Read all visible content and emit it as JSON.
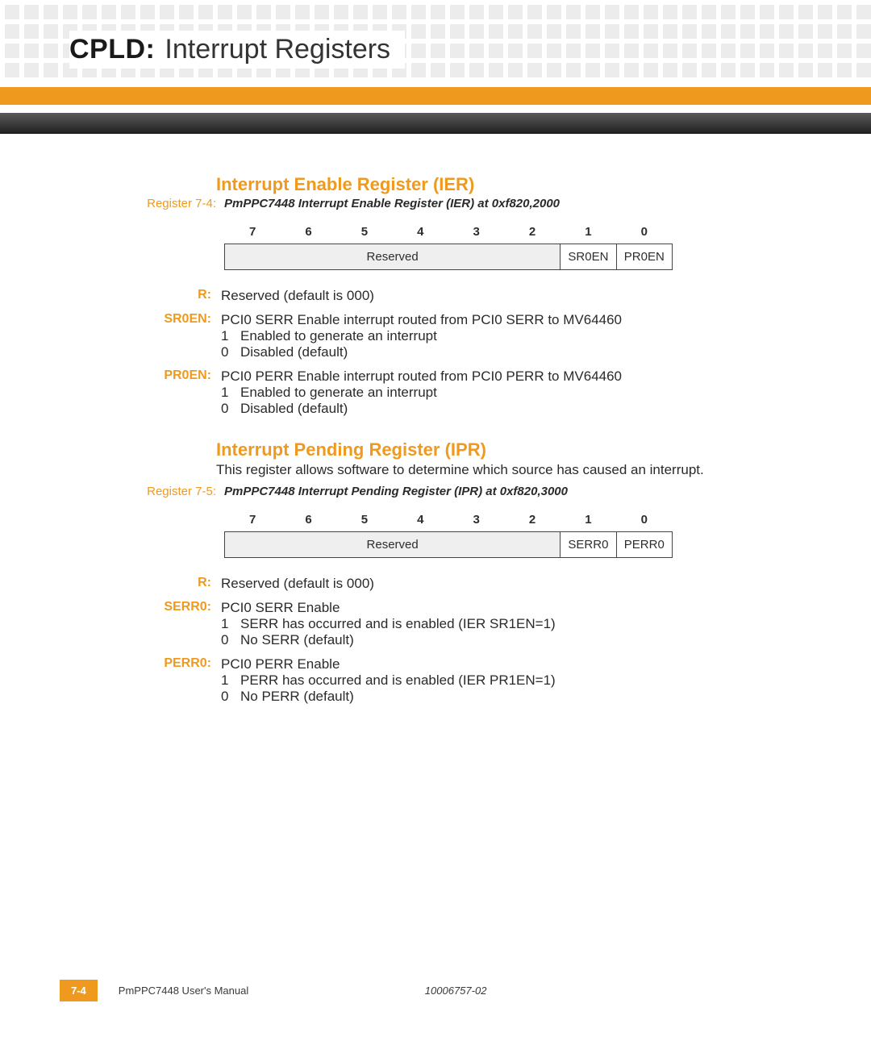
{
  "header": {
    "prefix": "CPLD:",
    "title": "Interrupt Registers"
  },
  "section1": {
    "heading": "Interrupt Enable Register (IER)",
    "reg_label": "Register 7-4:",
    "reg_caption": "PmPPC7448 Interrupt Enable Register (IER) at 0xf820,2000",
    "bits": [
      "7",
      "6",
      "5",
      "4",
      "3",
      "2",
      "1",
      "0"
    ],
    "cell_reserved": "Reserved",
    "cell_b1": "SR0EN",
    "cell_b0": "PR0EN",
    "defs": {
      "r_label": "R:",
      "r_text": "Reserved (default is 000)",
      "sr_label": "SR0EN:",
      "sr_text": "PCI0 SERR Enable interrupt routed from PCI0 SERR to MV64460",
      "sr_1n": "1",
      "sr_1t": "Enabled to generate an interrupt",
      "sr_0n": "0",
      "sr_0t": "Disabled (default)",
      "pr_label": "PR0EN:",
      "pr_text": "PCI0 PERR Enable interrupt routed from PCI0 PERR to MV64460",
      "pr_1n": "1",
      "pr_1t": "Enabled to generate an interrupt",
      "pr_0n": "0",
      "pr_0t": "Disabled (default)"
    }
  },
  "section2": {
    "heading": "Interrupt Pending Register (IPR)",
    "intro": "This register allows software to determine which source has caused an interrupt.",
    "reg_label": "Register 7-5:",
    "reg_caption": "PmPPC7448 Interrupt Pending Register (IPR) at 0xf820,3000",
    "bits": [
      "7",
      "6",
      "5",
      "4",
      "3",
      "2",
      "1",
      "0"
    ],
    "cell_reserved": "Reserved",
    "cell_b1": "SERR0",
    "cell_b0": "PERR0",
    "defs": {
      "r_label": "R:",
      "r_text": "Reserved (default is 000)",
      "se_label": "SERR0:",
      "se_text": "PCI0 SERR Enable",
      "se_1n": "1",
      "se_1t": "SERR has occurred and is enabled (IER SR1EN=1)",
      "se_0n": "0",
      "se_0t": "No SERR (default)",
      "pe_label": "PERR0:",
      "pe_text": "PCI0 PERR Enable",
      "pe_1n": "1",
      "pe_1t": "PERR has occurred and is enabled (IER PR1EN=1)",
      "pe_0n": "0",
      "pe_0t": "No PERR (default)"
    }
  },
  "footer": {
    "page": "7-4",
    "manual": "PmPPC7448 User's Manual",
    "code": "10006757-02"
  }
}
